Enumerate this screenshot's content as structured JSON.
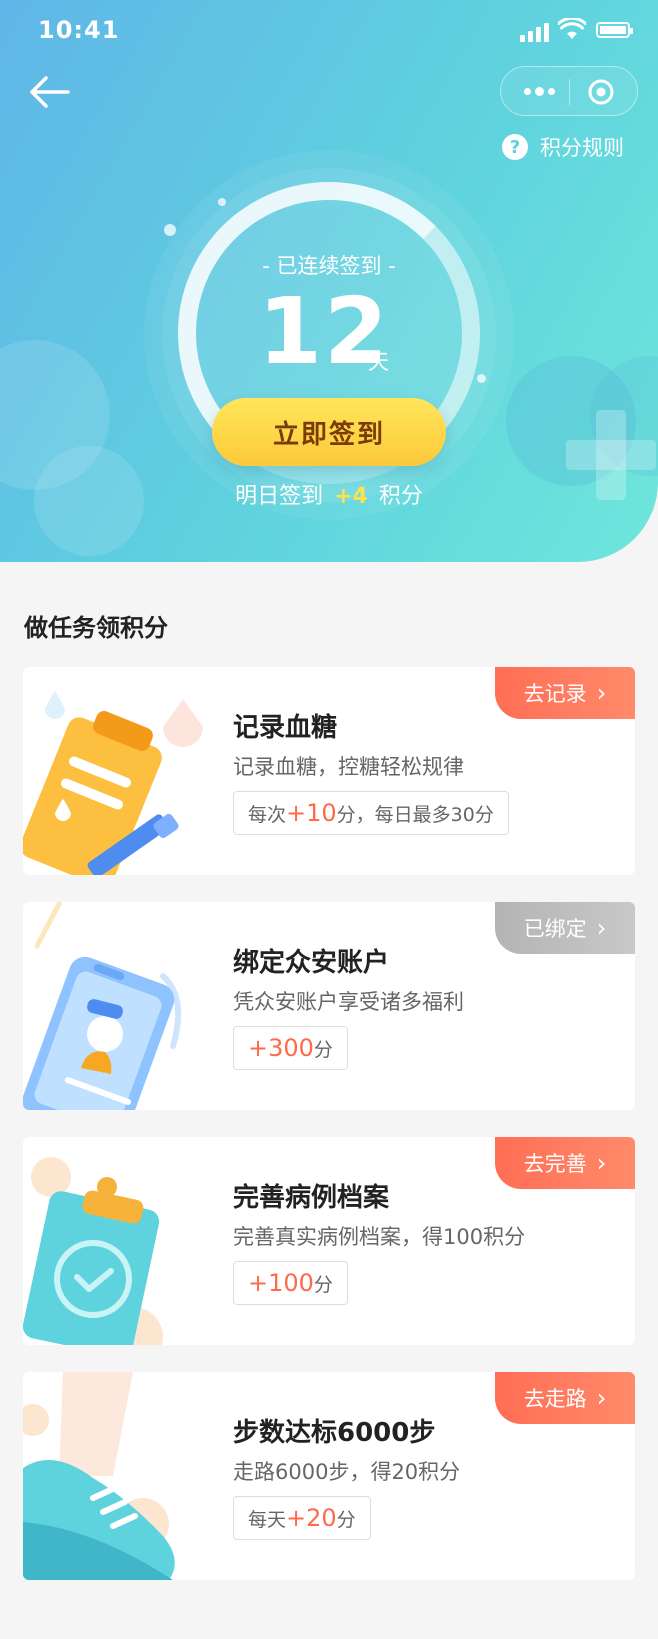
{
  "status_bar": {
    "time": "10:41"
  },
  "nav": {
    "rules_label": "积分规则"
  },
  "checkin": {
    "streak_label": "- 已连续签到 -",
    "streak_days": "12",
    "streak_unit": "天",
    "button_label": "立即签到",
    "tomorrow_prefix": "明日签到",
    "tomorrow_points": "+4",
    "tomorrow_suffix": "积分"
  },
  "tasks_section": {
    "title": "做任务领积分",
    "tasks": [
      {
        "title": "记录血糖",
        "desc": "记录血糖，控糖轻松规律",
        "reward_prefix": "每次",
        "reward_value": "+10",
        "reward_suffix": "分，每日最多30分",
        "action_label": "去记录",
        "action_state": "active",
        "icon": "clipboard-pen-icon"
      },
      {
        "title": "绑定众安账户",
        "desc": "凭众安账户享受诸多福利",
        "reward_prefix": "",
        "reward_value": "+300",
        "reward_suffix": "分",
        "action_label": "已绑定",
        "action_state": "done",
        "icon": "phone-account-icon"
      },
      {
        "title": "完善病例档案",
        "desc": "完善真实病例档案，得100积分",
        "reward_prefix": "",
        "reward_value": "+100",
        "reward_suffix": "分",
        "action_label": "去完善",
        "action_state": "active",
        "icon": "clipboard-check-icon"
      },
      {
        "title": "步数达标6000步",
        "desc": "走路6000步，得20积分",
        "reward_prefix": "每天",
        "reward_value": "+20",
        "reward_suffix": "分",
        "action_label": "去走路",
        "action_state": "active",
        "icon": "sneaker-icon"
      }
    ]
  },
  "colors": {
    "hero_start": "#5fb6e8",
    "hero_end": "#6ee6dc",
    "button_yellow": "#fcc93a",
    "points_highlight": "#ffe14d",
    "reward_highlight": "#ff6a4a",
    "action_orange": "#ff6e55",
    "action_gray": "#b4b4b4"
  }
}
